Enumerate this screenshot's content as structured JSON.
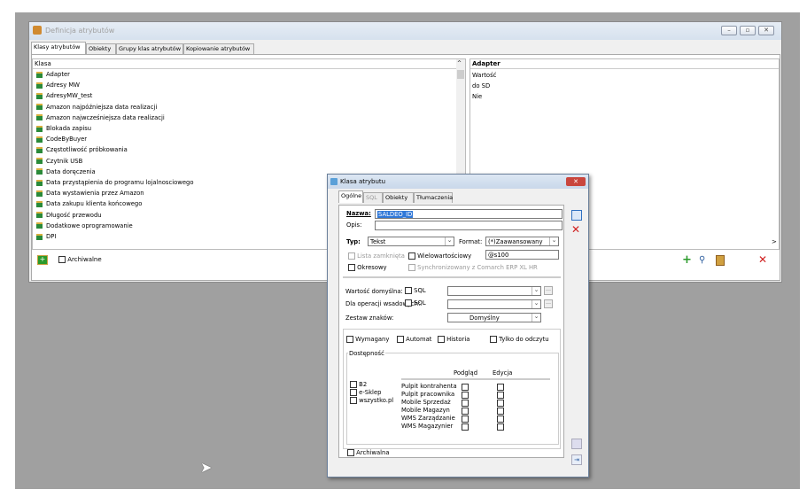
{
  "window": {
    "title": "Definicja atrybutów"
  },
  "tabs": [
    "Klasy atrybutów",
    "Obiekty",
    "Grupy klas atrybutów",
    "Kopiowanie atrybutów"
  ],
  "list": {
    "header": "Klasa",
    "items": [
      "Adapter",
      "Adresy MW",
      "AdresyMW_test",
      "Amazon najpóźniejsza data realizacji",
      "Amazon najwcześniejsza data realizacji",
      "Blokada zapisu",
      "CodeByBuyer",
      "Częstotliwość próbkowania",
      "Czytnik USB",
      "Data doręczenia",
      "Data przystąpienia do programu lojalnosciowego",
      "Data wystawienia przez Amazon",
      "Data zakupu klienta końcowego",
      "Długość przewodu",
      "Dodatkowe oprogramowanie",
      "DPI"
    ]
  },
  "right": {
    "header": "Adapter",
    "values": [
      "Wartość",
      "do SD",
      "Nie"
    ]
  },
  "bottom": {
    "archiwalne": "Archiwalne"
  },
  "dialog": {
    "title": "Klasa atrybutu",
    "tabs": [
      "Ogólne",
      "SQL",
      "Obiekty",
      "Tłumaczenia"
    ],
    "nazwa_label": "Nazwa:",
    "nazwa_value": "SALDEO_ID",
    "opis_label": "Opis:",
    "typ_label": "Typ:",
    "typ_value": "Tekst",
    "format_label": "Format:",
    "format_value": "(*)Zaawansowany",
    "lista_zamknieta": "Lista zamknięta",
    "wielowartosciowy": "Wielowartościowy",
    "format_mask": "@s100",
    "okresowy": "Okresowy",
    "synchronizowany": "Synchronizowany z Comarch ERP XL HR",
    "wartosc_domyslna": "Wartość domyślna:",
    "sql1": "SQL",
    "dla_operacji": "Dla operacji wsadowych:",
    "sql2": "SQL",
    "zestaw_znakow": "Zestaw znaków:",
    "zestaw_value": "Domyślny",
    "wymagany": "Wymagany",
    "automat": "Automat",
    "historia": "Historia",
    "tylko_do_odczytu": "Tylko do odczytu",
    "dostepnosc": "Dostępność",
    "left_checks": [
      "B2",
      "e-Sklep",
      "wszystko.pl"
    ],
    "col_podglad": "Podgląd",
    "col_edycja": "Edycja",
    "rows": [
      "Pulpit kontrahenta",
      "Pulpit pracownika",
      "Mobile Sprzedaż",
      "Mobile Magazyn",
      "WMS Zarządzanie",
      "WMS Magazynier"
    ],
    "archiwalna": "Archiwalna"
  },
  "colors": {
    "desktop": "#a0a0a0",
    "selection": "#3078d8",
    "delete": "#d02020",
    "add": "#2a9a2a"
  }
}
